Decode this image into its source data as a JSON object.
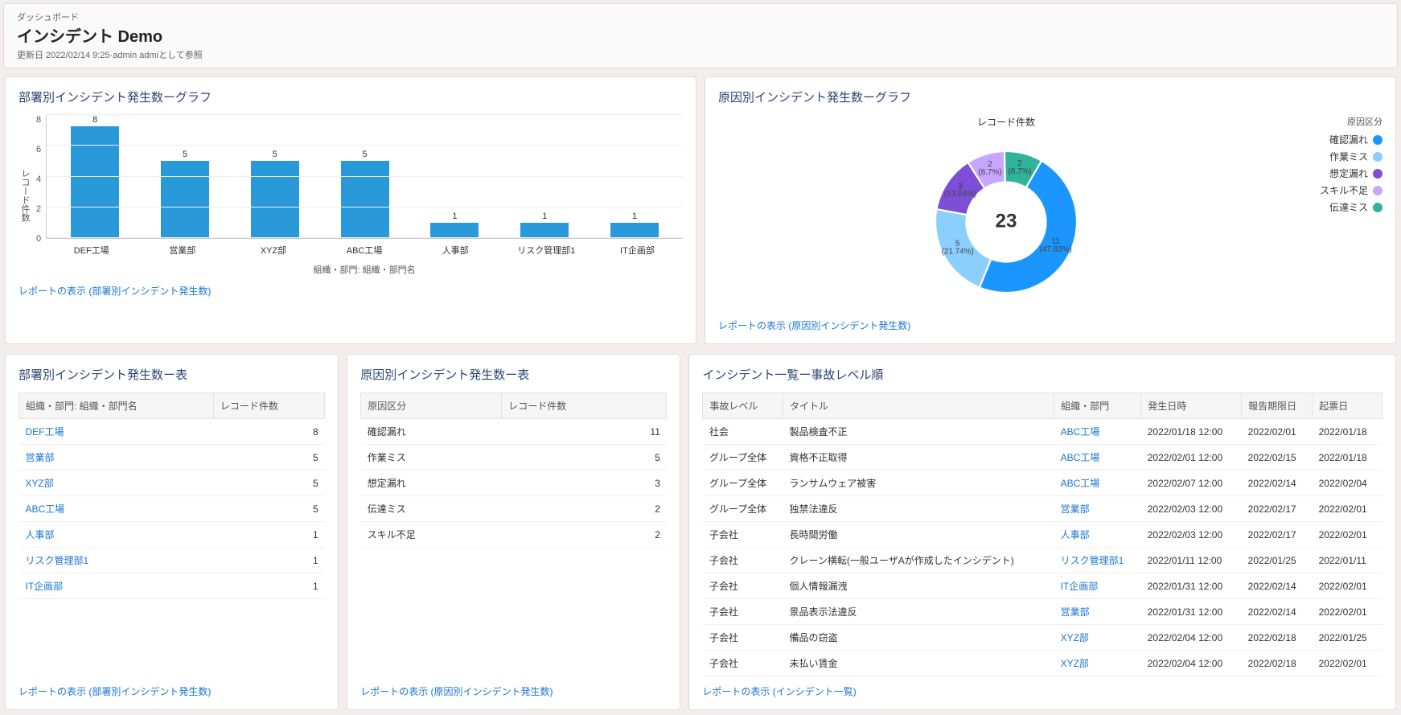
{
  "header": {
    "breadcrumb": "ダッシュボード",
    "title": "インシデント Demo",
    "meta": "更新日 2022/02/14 9:25·admin admiとして参照"
  },
  "cards": {
    "bar": {
      "title": "部署別インシデント発生数ーグラフ",
      "link": "レポートの表示 (部署別インシデント発生数)",
      "ylabel": "レコード件数",
      "xcaption": "組織・部門: 組織・部門名"
    },
    "donut": {
      "title": "原因別インシデント発生数ーグラフ",
      "link": "レポートの表示 (原因別インシデント発生数)",
      "inner_title": "レコード件数",
      "legend_title": "原因区分"
    },
    "table1": {
      "title": "部署別インシデント発生数ー表",
      "link": "レポートの表示 (部署別インシデント発生数)",
      "col1": "組織・部門: 組織・部門名",
      "col2": "レコード件数"
    },
    "table2": {
      "title": "原因別インシデント発生数ー表",
      "link": "レポートの表示 (原因別インシデント発生数)",
      "col1": "原因区分",
      "col2": "レコード件数"
    },
    "table3": {
      "title": "インシデント一覧ー事故レベル順",
      "link": "レポートの表示 (インシデント一覧)",
      "cols": [
        "事故レベル",
        "タイトル",
        "組織・部門",
        "発生日時",
        "報告期限日",
        "起票日"
      ]
    }
  },
  "chart_data": [
    {
      "type": "bar",
      "title": "部署別インシデント発生数ーグラフ",
      "categories": [
        "DEF工場",
        "営業部",
        "XYZ部",
        "ABC工場",
        "人事部",
        "リスク管理部1",
        "IT企画部"
      ],
      "values": [
        8,
        5,
        5,
        5,
        1,
        1,
        1
      ],
      "yticks": [
        0,
        2,
        4,
        6,
        8
      ],
      "ylim": [
        0,
        8
      ],
      "ylabel": "レコード件数",
      "xlabel": "組織・部門: 組織・部門名"
    },
    {
      "type": "donut",
      "title": "原因別インシデント発生数ーグラフ",
      "inner_title": "レコード件数",
      "total": 23,
      "series": [
        {
          "name": "確認漏れ",
          "value": 11,
          "pct": "47.83%",
          "color": "#1b96ff"
        },
        {
          "name": "作業ミス",
          "value": 5,
          "pct": "21.74%",
          "color": "#8bcfff"
        },
        {
          "name": "想定漏れ",
          "value": 3,
          "pct": "13.04%",
          "color": "#7d4ed8"
        },
        {
          "name": "スキル不足",
          "value": 2,
          "pct": "8.7%",
          "color": "#c7a6ff"
        },
        {
          "name": "伝達ミス",
          "value": 2,
          "pct": "8.7%",
          "color": "#2fb39b"
        }
      ]
    }
  ],
  "table1_rows": [
    {
      "name": "DEF工場",
      "count": 8
    },
    {
      "name": "営業部",
      "count": 5
    },
    {
      "name": "XYZ部",
      "count": 5
    },
    {
      "name": "ABC工場",
      "count": 5
    },
    {
      "name": "人事部",
      "count": 1
    },
    {
      "name": "リスク管理部1",
      "count": 1
    },
    {
      "name": "IT企画部",
      "count": 1
    }
  ],
  "table2_rows": [
    {
      "name": "確認漏れ",
      "count": 11
    },
    {
      "name": "作業ミス",
      "count": 5
    },
    {
      "name": "想定漏れ",
      "count": 3
    },
    {
      "name": "伝達ミス",
      "count": 2
    },
    {
      "name": "スキル不足",
      "count": 2
    }
  ],
  "table3_rows": [
    {
      "level": "社会",
      "title": "製品検査不正",
      "dept": "ABC工場",
      "occurred": "2022/01/18 12:00",
      "due": "2022/02/01",
      "created": "2022/01/18"
    },
    {
      "level": "グループ全体",
      "title": "資格不正取得",
      "dept": "ABC工場",
      "occurred": "2022/02/01 12:00",
      "due": "2022/02/15",
      "created": "2022/01/18"
    },
    {
      "level": "グループ全体",
      "title": "ランサムウェア被害",
      "dept": "ABC工場",
      "occurred": "2022/02/07 12:00",
      "due": "2022/02/14",
      "created": "2022/02/04"
    },
    {
      "level": "グループ全体",
      "title": "独禁法違反",
      "dept": "営業部",
      "occurred": "2022/02/03 12:00",
      "due": "2022/02/17",
      "created": "2022/02/01"
    },
    {
      "level": "子会社",
      "title": "長時間労働",
      "dept": "人事部",
      "occurred": "2022/02/03 12:00",
      "due": "2022/02/17",
      "created": "2022/02/01"
    },
    {
      "level": "子会社",
      "title": "クレーン横転(一般ユーザAが作成したインシデント)",
      "dept": "リスク管理部1",
      "occurred": "2022/01/11 12:00",
      "due": "2022/01/25",
      "created": "2022/01/11"
    },
    {
      "level": "子会社",
      "title": "個人情報漏洩",
      "dept": "IT企画部",
      "occurred": "2022/01/31 12:00",
      "due": "2022/02/14",
      "created": "2022/02/01"
    },
    {
      "level": "子会社",
      "title": "景品表示法違反",
      "dept": "営業部",
      "occurred": "2022/01/31 12:00",
      "due": "2022/02/14",
      "created": "2022/02/01"
    },
    {
      "level": "子会社",
      "title": "備品の窃盗",
      "dept": "XYZ部",
      "occurred": "2022/02/04 12:00",
      "due": "2022/02/18",
      "created": "2022/01/25"
    },
    {
      "level": "子会社",
      "title": "未払い賃金",
      "dept": "XYZ部",
      "occurred": "2022/02/04 12:00",
      "due": "2022/02/18",
      "created": "2022/02/01"
    }
  ]
}
